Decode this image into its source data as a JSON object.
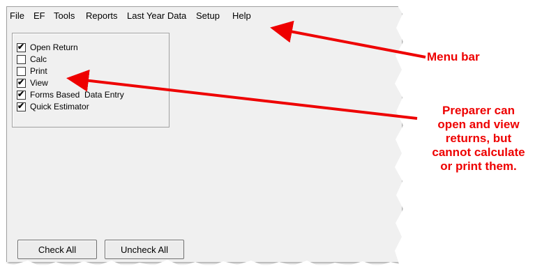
{
  "menu": {
    "items": [
      {
        "label": "File"
      },
      {
        "label": "EF"
      },
      {
        "label": "Tools"
      },
      {
        "label": "Reports"
      },
      {
        "label": "Last Year Data"
      },
      {
        "label": "Setup"
      },
      {
        "label": "Help"
      }
    ]
  },
  "permissions": [
    {
      "label": "Open Return",
      "checked": true
    },
    {
      "label": "Calc",
      "checked": false
    },
    {
      "label": "Print",
      "checked": false
    },
    {
      "label": "View",
      "checked": true
    },
    {
      "label": "Forms Based  Data Entry",
      "checked": true
    },
    {
      "label": "Quick Estimator",
      "checked": true
    }
  ],
  "buttons": {
    "check_all": "Check All",
    "uncheck_all": "Uncheck All"
  },
  "annotations": {
    "menu_bar": "Menu bar",
    "preparer": [
      "Preparer can",
      "open and view",
      "returns, but",
      "cannot calculate",
      "or print them."
    ]
  },
  "colors": {
    "annotation": "#ee0000",
    "window_bg": "#f0f0f0"
  }
}
